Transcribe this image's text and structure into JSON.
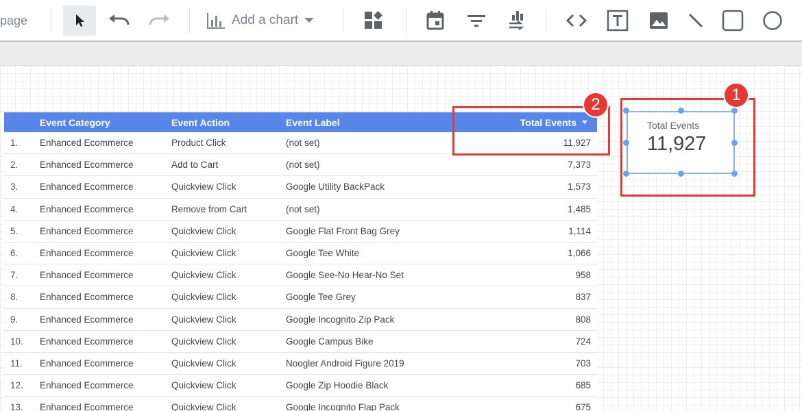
{
  "toolbar": {
    "page_label": "page",
    "add_chart_label": "Add a chart"
  },
  "table": {
    "headers": {
      "category": "Event Category",
      "action": "Event Action",
      "label": "Event Label",
      "total": "Total Events"
    },
    "rows": [
      {
        "num": "1.",
        "category": "Enhanced Ecommerce",
        "action": "Product Click",
        "label": "(not set)",
        "total": "11,927"
      },
      {
        "num": "2.",
        "category": "Enhanced Ecommerce",
        "action": "Add to Cart",
        "label": "(not set)",
        "total": "7,373"
      },
      {
        "num": "3.",
        "category": "Enhanced Ecommerce",
        "action": "Quickview Click",
        "label": "Google Utility BackPack",
        "total": "1,573"
      },
      {
        "num": "4.",
        "category": "Enhanced Ecommerce",
        "action": "Remove from Cart",
        "label": "(not set)",
        "total": "1,485"
      },
      {
        "num": "5.",
        "category": "Enhanced Ecommerce",
        "action": "Quickview Click",
        "label": "Google Flat Front Bag Grey",
        "total": "1,114"
      },
      {
        "num": "6.",
        "category": "Enhanced Ecommerce",
        "action": "Quickview Click",
        "label": "Google Tee White",
        "total": "1,066"
      },
      {
        "num": "7.",
        "category": "Enhanced Ecommerce",
        "action": "Quickview Click",
        "label": "Google See-No Hear-No Set",
        "total": "958"
      },
      {
        "num": "8.",
        "category": "Enhanced Ecommerce",
        "action": "Quickview Click",
        "label": "Google Tee Grey",
        "total": "837"
      },
      {
        "num": "9.",
        "category": "Enhanced Ecommerce",
        "action": "Quickview Click",
        "label": "Google Incognito Zip Pack",
        "total": "808"
      },
      {
        "num": "10.",
        "category": "Enhanced Ecommerce",
        "action": "Quickview Click",
        "label": "Google Campus Bike",
        "total": "724"
      },
      {
        "num": "11.",
        "category": "Enhanced Ecommerce",
        "action": "Quickview Click",
        "label": "Noogler Android Figure 2019",
        "total": "703"
      },
      {
        "num": "12.",
        "category": "Enhanced Ecommerce",
        "action": "Quickview Click",
        "label": "Google Zip Hoodie Black",
        "total": "685"
      },
      {
        "num": "13.",
        "category": "Enhanced Ecommerce",
        "action": "Quickview Click",
        "label": "Google Incognito Flap Pack",
        "total": "675"
      }
    ]
  },
  "scorecard": {
    "title": "Total Events",
    "value": "11,927"
  },
  "annotations": {
    "badge_1": "1",
    "badge_2": "2"
  },
  "colors": {
    "header_blue": "#5886e8",
    "highlight_red": "#e53935",
    "selection_blue": "#8ab4e8"
  }
}
